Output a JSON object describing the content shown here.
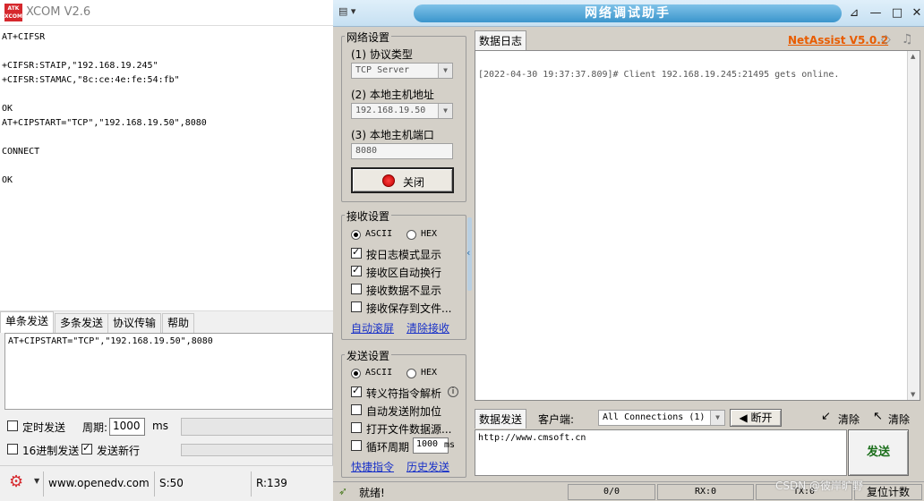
{
  "xcom": {
    "title": "XCOM V2.6",
    "logo_text": "ATK XCOM",
    "recv_text": "AT+CIFSR\n\n+CIFSR:STAIP,\"192.168.19.245\"\n+CIFSR:STAMAC,\"8c:ce:4e:fe:54:fb\"\n\nOK\nAT+CIPSTART=\"TCP\",\"192.168.19.50\",8080\n\nCONNECT\n\nOK",
    "tabs": [
      "单条发送",
      "多条发送",
      "协议传输",
      "帮助"
    ],
    "send_text": "AT+CIPSTART=\"TCP\",\"192.168.19.50\",8080",
    "timed_send_label": "定时发送",
    "period_label": "周期:",
    "period_value": "1000",
    "period_unit": "ms",
    "hex_send_label": "16进制发送",
    "newline_label": "发送新行",
    "status_url": "www.openedv.com",
    "status_s": "S:50",
    "status_r": "R:139"
  },
  "netassist": {
    "title": "网络调试助手",
    "brand": "NetAssist V5.0.2",
    "net_settings": {
      "title": "网络设置",
      "protocol_label": "(1) 协议类型",
      "protocol_value": "TCP Server",
      "host_label": "(2) 本地主机地址",
      "host_value": "192.168.19.50",
      "port_label": "(3) 本地主机端口",
      "port_value": "8080",
      "close_button": "关闭"
    },
    "recv_settings": {
      "title": "接收设置",
      "ascii": "ASCII",
      "hex": "HEX",
      "opt1": "按日志模式显示",
      "opt2": "接收区自动换行",
      "opt3": "接收数据不显示",
      "opt4": "接收保存到文件...",
      "link1": "自动滚屏",
      "link2": "清除接收"
    },
    "send_settings": {
      "title": "发送设置",
      "ascii": "ASCII",
      "hex": "HEX",
      "opt1": "转义符指令解析",
      "opt2": "自动发送附加位",
      "opt3": "打开文件数据源...",
      "opt4": "循环周期",
      "period_value": "1000",
      "period_unit": "ms",
      "link1": "快捷指令",
      "link2": "历史发送"
    },
    "log_tab": "数据日志",
    "log_text": "[2022-04-30 19:37:37.809]# Client 192.168.19.245:21495 gets online.",
    "send_tab": "数据发送",
    "client_label": "客户端:",
    "client_value": "All Connections (1)",
    "disconnect_button": "断开",
    "clear_button": "清除",
    "reset_button": "清除",
    "send_text": "http://www.cmsoft.cn",
    "send_button": "发送",
    "status_ready": "就绪!",
    "status_count": "0/0",
    "status_rx": "RX:0",
    "status_tx": "TX:0",
    "status_reset": "复位计数"
  },
  "watermark": "CSDN @彼岸旷野"
}
